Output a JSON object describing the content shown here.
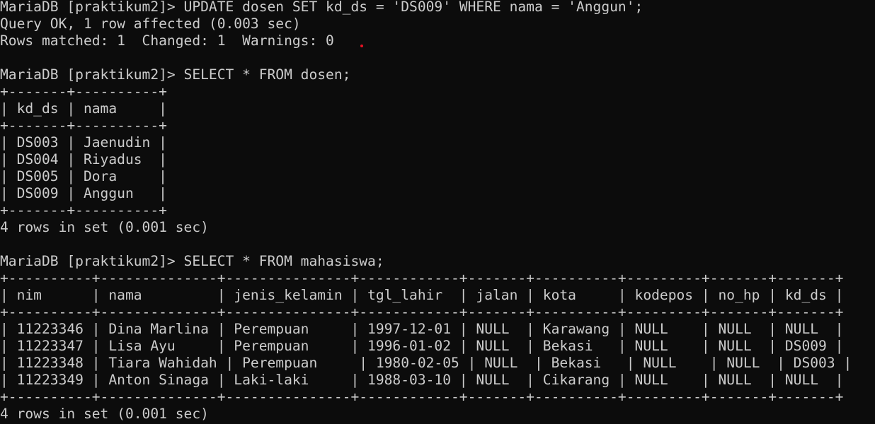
{
  "terminal": {
    "lines": [
      "MariaDB [praktikum2]> UPDATE dosen SET kd_ds = 'DS009' WHERE nama = 'Anggun';",
      "Query OK, 1 row affected (0.003 sec)",
      "Rows matched: 1  Changed: 1  Warnings: 0",
      "",
      "MariaDB [praktikum2]> SELECT * FROM dosen;",
      "+-------+----------+",
      "| kd_ds | nama     |",
      "+-------+----------+",
      "| DS003 | Jaenudin |",
      "| DS004 | Riyadus  |",
      "| DS005 | Dora     |",
      "| DS009 | Anggun   |",
      "+-------+----------+",
      "4 rows in set (0.001 sec)",
      "",
      "MariaDB [praktikum2]> SELECT * FROM mahasiswa;",
      "+----------+--------------+---------------+------------+-------+----------+---------+-------+-------+",
      "| nim      | nama         | jenis_kelamin | tgl_lahir  | jalan | kota     | kodepos | no_hp | kd_ds |",
      "+----------+--------------+---------------+------------+-------+----------+---------+-------+-------+",
      "| 11223346 | Dina Marlina | Perempuan     | 1997-12-01 | NULL  | Karawang | NULL    | NULL  | NULL  |",
      "| 11223347 | Lisa Ayu     | Perempuan     | 1996-01-02 | NULL  | Bekasi   | NULL    | NULL  | DS009 |",
      "| 11223348 | Tiara Wahidah | Perempuan     | 1980-02-05 | NULL  | Bekasi   | NULL    | NULL  | DS003 |",
      "| 11223349 | Anton Sinaga | Laki-laki     | 1988-03-10 | NULL  | Cikarang | NULL    | NULL  | NULL  |",
      "+----------+--------------+---------------+------------+-------+----------+---------+-------+-------+",
      "4 rows in set (0.001 sec)"
    ]
  }
}
